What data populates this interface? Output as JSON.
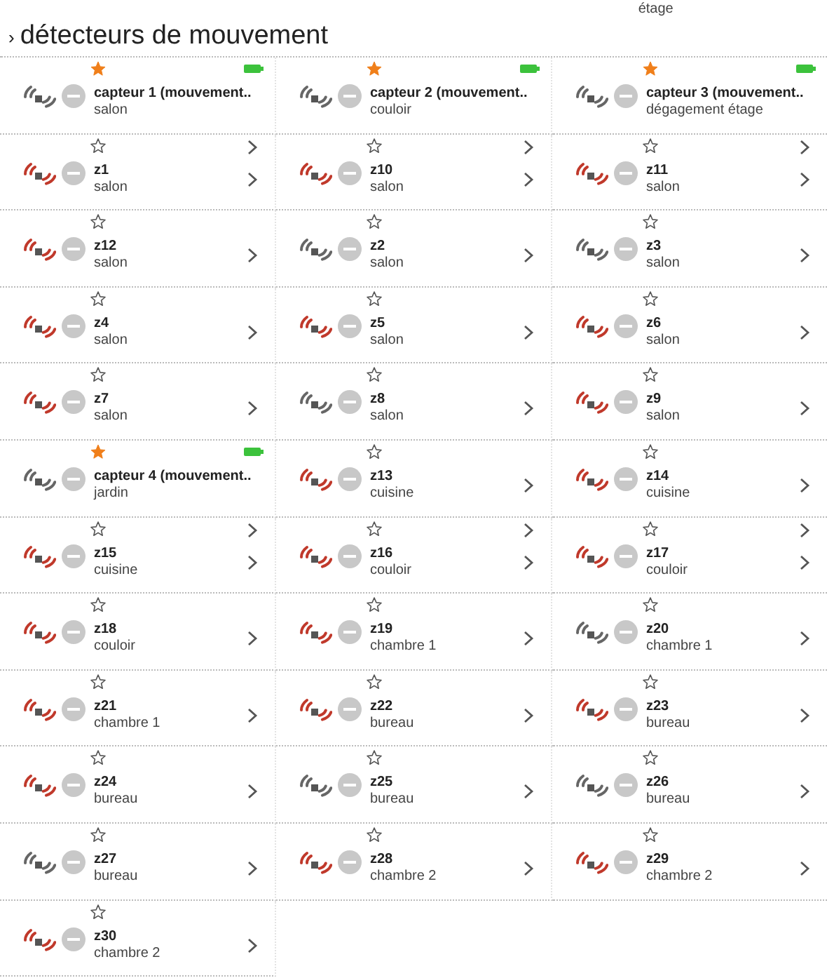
{
  "previous_row_tail": [
    {
      "text": "étage"
    }
  ],
  "section": {
    "title": "détecteurs de mouvement",
    "collapse_glyph": "›"
  },
  "cells": [
    {
      "name": "capteur 1 (mouvement..",
      "room": "salon",
      "starred": true,
      "motion": false,
      "battery": true,
      "chevron": false,
      "top_chevron": false
    },
    {
      "name": "capteur 2 (mouvement..",
      "room": "couloir",
      "starred": true,
      "motion": false,
      "battery": true,
      "chevron": false,
      "top_chevron": false
    },
    {
      "name": "capteur 3 (mouvement..",
      "room": "dégagement étage",
      "starred": true,
      "motion": false,
      "battery": true,
      "chevron": false,
      "top_chevron": false
    },
    {
      "name": "z1",
      "room": "salon",
      "starred": false,
      "motion": true,
      "battery": false,
      "chevron": true,
      "top_chevron": true
    },
    {
      "name": "z10",
      "room": "salon",
      "starred": false,
      "motion": true,
      "battery": false,
      "chevron": true,
      "top_chevron": true
    },
    {
      "name": "z11",
      "room": "salon",
      "starred": false,
      "motion": true,
      "battery": false,
      "chevron": true,
      "top_chevron": true
    },
    {
      "name": "z12",
      "room": "salon",
      "starred": false,
      "motion": true,
      "battery": false,
      "chevron": true,
      "top_chevron": false
    },
    {
      "name": "z2",
      "room": "salon",
      "starred": false,
      "motion": false,
      "battery": false,
      "chevron": true,
      "top_chevron": false
    },
    {
      "name": "z3",
      "room": "salon",
      "starred": false,
      "motion": false,
      "battery": false,
      "chevron": true,
      "top_chevron": false
    },
    {
      "name": "z4",
      "room": "salon",
      "starred": false,
      "motion": true,
      "battery": false,
      "chevron": true,
      "top_chevron": false
    },
    {
      "name": "z5",
      "room": "salon",
      "starred": false,
      "motion": true,
      "battery": false,
      "chevron": true,
      "top_chevron": false
    },
    {
      "name": "z6",
      "room": "salon",
      "starred": false,
      "motion": true,
      "battery": false,
      "chevron": true,
      "top_chevron": false
    },
    {
      "name": "z7",
      "room": "salon",
      "starred": false,
      "motion": true,
      "battery": false,
      "chevron": true,
      "top_chevron": false
    },
    {
      "name": "z8",
      "room": "salon",
      "starred": false,
      "motion": false,
      "battery": false,
      "chevron": true,
      "top_chevron": false
    },
    {
      "name": "z9",
      "room": "salon",
      "starred": false,
      "motion": true,
      "battery": false,
      "chevron": true,
      "top_chevron": false
    },
    {
      "name": "capteur 4 (mouvement..",
      "room": "jardin",
      "starred": true,
      "motion": false,
      "battery": true,
      "chevron": false,
      "top_chevron": false
    },
    {
      "name": "z13",
      "room": "cuisine",
      "starred": false,
      "motion": true,
      "battery": false,
      "chevron": true,
      "top_chevron": false
    },
    {
      "name": "z14",
      "room": "cuisine",
      "starred": false,
      "motion": true,
      "battery": false,
      "chevron": true,
      "top_chevron": false
    },
    {
      "name": "z15",
      "room": "cuisine",
      "starred": false,
      "motion": true,
      "battery": false,
      "chevron": true,
      "top_chevron": true
    },
    {
      "name": "z16",
      "room": "couloir",
      "starred": false,
      "motion": true,
      "battery": false,
      "chevron": true,
      "top_chevron": true
    },
    {
      "name": "z17",
      "room": "couloir",
      "starred": false,
      "motion": true,
      "battery": false,
      "chevron": true,
      "top_chevron": true
    },
    {
      "name": "z18",
      "room": "couloir",
      "starred": false,
      "motion": true,
      "battery": false,
      "chevron": true,
      "top_chevron": false
    },
    {
      "name": "z19",
      "room": "chambre 1",
      "starred": false,
      "motion": true,
      "battery": false,
      "chevron": true,
      "top_chevron": false
    },
    {
      "name": "z20",
      "room": "chambre 1",
      "starred": false,
      "motion": false,
      "battery": false,
      "chevron": true,
      "top_chevron": false
    },
    {
      "name": "z21",
      "room": "chambre 1",
      "starred": false,
      "motion": true,
      "battery": false,
      "chevron": true,
      "top_chevron": false
    },
    {
      "name": "z22",
      "room": "bureau",
      "starred": false,
      "motion": true,
      "battery": false,
      "chevron": true,
      "top_chevron": false
    },
    {
      "name": "z23",
      "room": "bureau",
      "starred": false,
      "motion": true,
      "battery": false,
      "chevron": true,
      "top_chevron": false
    },
    {
      "name": "z24",
      "room": "bureau",
      "starred": false,
      "motion": true,
      "battery": false,
      "chevron": true,
      "top_chevron": false
    },
    {
      "name": "z25",
      "room": "bureau",
      "starred": false,
      "motion": false,
      "battery": false,
      "chevron": true,
      "top_chevron": false
    },
    {
      "name": "z26",
      "room": "bureau",
      "starred": false,
      "motion": false,
      "battery": false,
      "chevron": true,
      "top_chevron": false
    },
    {
      "name": "z27",
      "room": "bureau",
      "starred": false,
      "motion": false,
      "battery": false,
      "chevron": true,
      "top_chevron": false
    },
    {
      "name": "z28",
      "room": "chambre 2",
      "starred": false,
      "motion": true,
      "battery": false,
      "chevron": true,
      "top_chevron": false
    },
    {
      "name": "z29",
      "room": "chambre 2",
      "starred": false,
      "motion": true,
      "battery": false,
      "chevron": true,
      "top_chevron": false
    },
    {
      "name": "z30",
      "room": "chambre 2",
      "starred": false,
      "motion": true,
      "battery": false,
      "chevron": true,
      "top_chevron": false
    }
  ]
}
